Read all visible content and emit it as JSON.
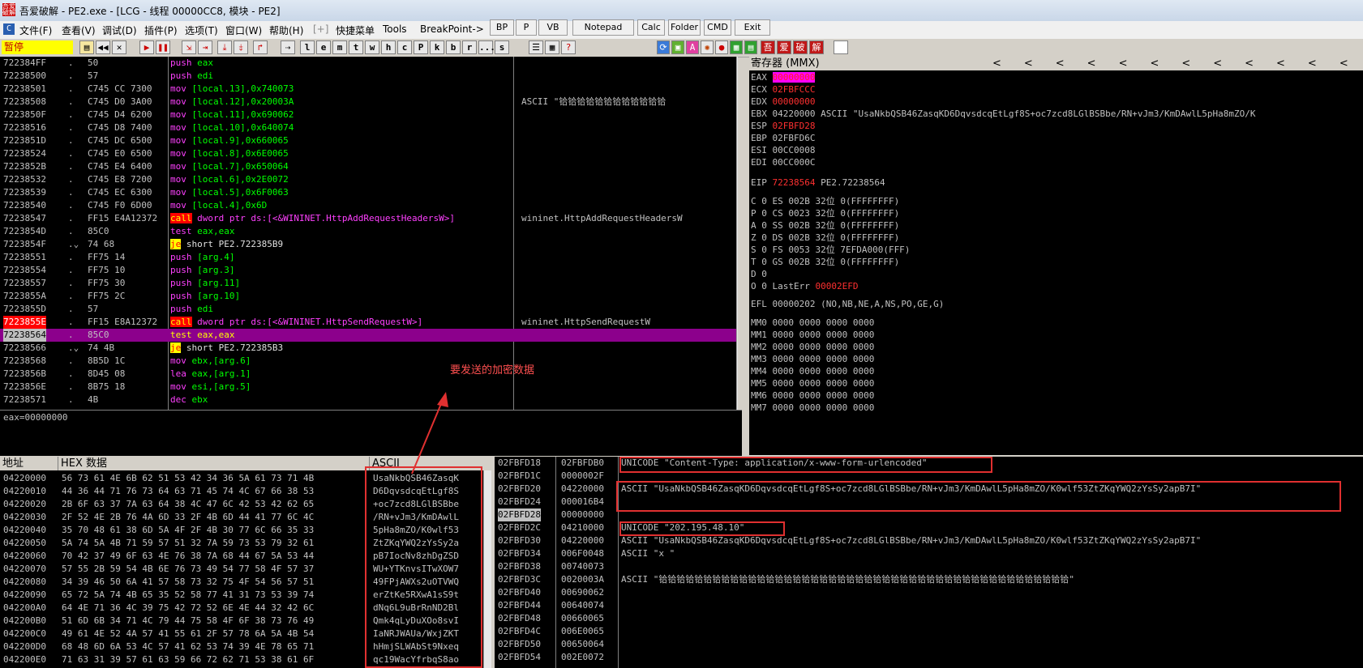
{
  "window": {
    "title": "吾爱破解 - PE2.exe - [LCG - 线程 00000CC8, 模块 - PE2]",
    "logo_text": "吾爱破解"
  },
  "menu": [
    "文件(F)",
    "查看(V)",
    "调试(D)",
    "插件(P)",
    "选项(T)",
    "窗口(W)",
    "帮助(H)",
    "[+]",
    "快捷菜单",
    "Tools",
    "BreakPoint->"
  ],
  "tool_buttons": [
    "BP",
    "P",
    "VB",
    "Notepad",
    "Calc",
    "Folder",
    "CMD",
    "Exit"
  ],
  "toolbar": {
    "status": "暂停",
    "letters": [
      "l",
      "e",
      "m",
      "t",
      "w",
      "h",
      "c",
      "P",
      "k",
      "b",
      "r",
      "...",
      "s"
    ],
    "right_icons": [
      "吾",
      "爱",
      "破",
      "解"
    ]
  },
  "disasm": {
    "rows": [
      {
        "addr": "722384FF",
        "mark": ".",
        "hex": "50",
        "m": "push",
        "a": "eax",
        "cmt": ""
      },
      {
        "addr": "72238500",
        "mark": ".",
        "hex": "57",
        "m": "push",
        "a": "edi",
        "cmt": ""
      },
      {
        "addr": "72238501",
        "mark": ".",
        "hex": "C745 CC 7300",
        "m": "mov",
        "a": "[local.13],0x740073",
        "cmt": ""
      },
      {
        "addr": "72238508",
        "mark": ".",
        "hex": "C745 D0 3A00",
        "m": "mov",
        "a": "[local.12],0x20003A",
        "cmt": "ASCII \"铪铪铪铪铪铪铪铪铪铪铪铪"
      },
      {
        "addr": "7223850F",
        "mark": ".",
        "hex": "C745 D4 6200",
        "m": "mov",
        "a": "[local.11],0x690062",
        "cmt": ""
      },
      {
        "addr": "72238516",
        "mark": ".",
        "hex": "C745 D8 7400",
        "m": "mov",
        "a": "[local.10],0x640074",
        "cmt": ""
      },
      {
        "addr": "7223851D",
        "mark": ".",
        "hex": "C745 DC 6500",
        "m": "mov",
        "a": "[local.9],0x660065",
        "cmt": ""
      },
      {
        "addr": "72238524",
        "mark": ".",
        "hex": "C745 E0 6500",
        "m": "mov",
        "a": "[local.8],0x6E0065",
        "cmt": ""
      },
      {
        "addr": "7223852B",
        "mark": ".",
        "hex": "C745 E4 6400",
        "m": "mov",
        "a": "[local.7],0x650064",
        "cmt": ""
      },
      {
        "addr": "72238532",
        "mark": ".",
        "hex": "C745 E8 7200",
        "m": "mov",
        "a": "[local.6],0x2E0072",
        "cmt": ""
      },
      {
        "addr": "72238539",
        "mark": ".",
        "hex": "C745 EC 6300",
        "m": "mov",
        "a": "[local.5],0x6F0063",
        "cmt": ""
      },
      {
        "addr": "72238540",
        "mark": ".",
        "hex": "C745 F0 6D00",
        "m": "mov",
        "a": "[local.4],0x6D",
        "cmt": ""
      },
      {
        "addr": "72238547",
        "mark": ".",
        "hex": "FF15 E4A12372",
        "m": "call",
        "a": "dword ptr ds:[<&WININET.HttpAddRequestHeadersW>]",
        "cmt": "wininet.HttpAddRequestHeadersW"
      },
      {
        "addr": "7223854D",
        "mark": ".",
        "hex": "85C0",
        "m": "test",
        "a": "eax,eax",
        "cmt": ""
      },
      {
        "addr": "7223854F",
        "mark": ".⌄",
        "hex": "74 68",
        "m": "je",
        "a": "short PE2.722385B9",
        "cmt": ""
      },
      {
        "addr": "72238551",
        "mark": ".",
        "hex": "FF75 14",
        "m": "push",
        "a": "[arg.4]",
        "cmt": ""
      },
      {
        "addr": "72238554",
        "mark": ".",
        "hex": "FF75 10",
        "m": "push",
        "a": "[arg.3]",
        "cmt": ""
      },
      {
        "addr": "72238557",
        "mark": ".",
        "hex": "FF75 30",
        "m": "push",
        "a": "[arg.11]",
        "cmt": ""
      },
      {
        "addr": "7223855A",
        "mark": ".",
        "hex": "FF75 2C",
        "m": "push",
        "a": "[arg.10]",
        "cmt": ""
      },
      {
        "addr": "7223855D",
        "mark": ".",
        "hex": "57",
        "m": "push",
        "a": "edi",
        "cmt": ""
      },
      {
        "addr": "7223855E",
        "mark": ".",
        "hex": "FF15 E8A12372",
        "m": "call",
        "a": "dword ptr ds:[<&WININET.HttpSendRequestW>]",
        "cmt": "wininet.HttpSendRequestW"
      },
      {
        "addr": "72238564",
        "mark": ".",
        "hex": "85C0",
        "m": "test",
        "a": "eax,eax",
        "cmt": ""
      },
      {
        "addr": "72238566",
        "mark": ".⌄",
        "hex": "74 4B",
        "m": "je",
        "a": "short PE2.722385B3",
        "cmt": ""
      },
      {
        "addr": "72238568",
        "mark": ".",
        "hex": "8B5D 1C",
        "m": "mov",
        "a": "ebx,[arg.6]",
        "cmt": ""
      },
      {
        "addr": "7223856B",
        "mark": ".",
        "hex": "8D45 08",
        "m": "lea",
        "a": "eax,[arg.1]",
        "cmt": ""
      },
      {
        "addr": "7223856E",
        "mark": ".",
        "hex": "8B75 18",
        "m": "mov",
        "a": "esi,[arg.5]",
        "cmt": ""
      },
      {
        "addr": "72238571",
        "mark": ".",
        "hex": "4B",
        "m": "dec",
        "a": "ebx",
        "cmt": ""
      }
    ],
    "annotation": "要发送的加密数据"
  },
  "info_line": "eax=00000000",
  "registers": {
    "header": "寄存器 (MMX)",
    "lines": [
      {
        "n": "EAX",
        "v": "00000000",
        "x": "",
        "chg": true
      },
      {
        "n": "ECX",
        "v": "02FBFCCC",
        "x": "",
        "chg": true
      },
      {
        "n": "EDX",
        "v": "00000000",
        "x": "",
        "chg": true
      },
      {
        "n": "EBX",
        "v": "04220000",
        "x": "ASCII \"UsaNkbQSB46ZasqKD6DqvsdcqEtLgf8S+oc7zcd8LGlBSBbe/RN+vJm3/KmDAwlL5pHa8mZO/K",
        "chg": false
      },
      {
        "n": "ESP",
        "v": "02FBFD28",
        "x": "",
        "chg": true
      },
      {
        "n": "EBP",
        "v": "02FBFD6C",
        "x": "",
        "chg": false
      },
      {
        "n": "ESI",
        "v": "00CC0008",
        "x": "",
        "chg": false
      },
      {
        "n": "EDI",
        "v": "00CC000C",
        "x": "",
        "chg": false
      }
    ],
    "eip": {
      "n": "EIP",
      "v": "72238564",
      "x": "PE2.72238564"
    },
    "flags": [
      "C 0  ES 002B 32位 0(FFFFFFFF)",
      "P 0  CS 0023 32位 0(FFFFFFFF)",
      "A 0  SS 002B 32位 0(FFFFFFFF)",
      "Z 0  DS 002B 32位 0(FFFFFFFF)",
      "S 0  FS 0053 32位 7EFDA000(FFF)",
      "T 0  GS 002B 32位 0(FFFFFFFF)",
      "D 0",
      "O 0  LastErr "
    ],
    "lasterr": "00002EFD",
    "efl": "EFL 00000202 (NO,NB,NE,A,NS,PO,GE,G)",
    "mmx": [
      "MM0 0000 0000 0000 0000",
      "MM1 0000 0000 0000 0000",
      "MM2 0000 0000 0000 0000",
      "MM3 0000 0000 0000 0000",
      "MM4 0000 0000 0000 0000",
      "MM5 0000 0000 0000 0000",
      "MM6 0000 0000 0000 0000",
      "MM7 0000 0000 0000 0000"
    ]
  },
  "dump": {
    "headers": {
      "addr": "地址",
      "hex": "HEX 数据",
      "ascii": "ASCII"
    },
    "rows": [
      {
        "a": "04220000",
        "h": "56 73 61 4E 6B 62 51 53 42 34 36 5A 61 73 71 4B",
        "s": "UsaNkbQSB46ZasqK"
      },
      {
        "a": "04220010",
        "h": "44 36 44 71 76 73 64 63 71 45 74 4C 67 66 38 53",
        "s": "D6DqvsdcqEtLgf8S"
      },
      {
        "a": "04220020",
        "h": "2B 6F 63 37 7A 63 64 38 4C 47 6C 42 53 42 62 65",
        "s": "+oc7zcd8LGlBSBbe"
      },
      {
        "a": "04220030",
        "h": "2F 52 4E 2B 76 4A 6D 33 2F 4B 6D 44 41 77 6C 4C",
        "s": "/RN+vJm3/KmDAwlL"
      },
      {
        "a": "04220040",
        "h": "35 70 48 61 38 6D 5A 4F 2F 4B 30 77 6C 66 35 33",
        "s": "5pHa8mZO/K0wlf53"
      },
      {
        "a": "04220050",
        "h": "5A 74 5A 4B 71 59 57 51 32 7A 59 73 53 79 32 61",
        "s": "ZtZKqYWQ2zYsSy2a"
      },
      {
        "a": "04220060",
        "h": "70 42 37 49 6F 63 4E 76 38 7A 68 44 67 5A 53 44",
        "s": "pB7IocNv8zhDgZSD"
      },
      {
        "a": "04220070",
        "h": "57 55 2B 59 54 4B 6E 76 73 49 54 77 58 4F 57 37",
        "s": "WU+YTKnvsITwXOW7"
      },
      {
        "a": "04220080",
        "h": "34 39 46 50 6A 41 57 58 73 32 75 4F 54 56 57 51",
        "s": "49FPjAWXs2uOTVWQ"
      },
      {
        "a": "04220090",
        "h": "65 72 5A 74 4B 65 35 52 58 77 41 31 73 53 39 74",
        "s": "erZtKe5RXwA1sS9t"
      },
      {
        "a": "042200A0",
        "h": "64 4E 71 36 4C 39 75 42 72 52 6E 4E 44 32 42 6C",
        "s": "dNq6L9uBrRnND2Bl"
      },
      {
        "a": "042200B0",
        "h": "51 6D 6B 34 71 4C 79 44 75 58 4F 6F 38 73 76 49",
        "s": "Qmk4qLyDuXOo8svI"
      },
      {
        "a": "042200C0",
        "h": "49 61 4E 52 4A 57 41 55 61 2F 57 78 6A 5A 4B 54",
        "s": "IaNRJWAUa/WxjZKT"
      },
      {
        "a": "042200D0",
        "h": "68 48 6D 6A 53 4C 57 41 62 53 74 39 4E 78 65 71",
        "s": "hHmjSLWAbSt9Nxeq"
      },
      {
        "a": "042200E0",
        "h": "71 63 31 39 57 61 63 59 66 72 62 71 53 38 61 6F",
        "s": "qc19WacYfrbqS8ao"
      }
    ]
  },
  "stack": {
    "rows": [
      {
        "a": "02FBFD18",
        "v": "02FBFDB0",
        "c": "UNICODE \"Content-Type: application/x-www-form-urlencoded\""
      },
      {
        "a": "02FBFD1C",
        "v": "0000002F",
        "c": ""
      },
      {
        "a": "02FBFD20",
        "v": "04220000",
        "c": "ASCII \"UsaNkbQSB46ZasqKD6DqvsdcqEtLgf8S+oc7zcd8LGlBSBbe/RN+vJm3/KmDAwlL5pHa8mZO/K0wlf53ZtZKqYWQ2zYsSy2apB7I\""
      },
      {
        "a": "02FBFD24",
        "v": "000016B4",
        "c": ""
      },
      {
        "a": "02FBFD28",
        "v": "00000000",
        "c": ""
      },
      {
        "a": "02FBFD2C",
        "v": "04210000",
        "c": "UNICODE \"202.195.48.10\""
      },
      {
        "a": "02FBFD30",
        "v": "04220000",
        "c": "ASCII \"UsaNkbQSB46ZasqKD6DqvsdcqEtLgf8S+oc7zcd8LGlBSBbe/RN+vJm3/KmDAwlL5pHa8mZO/K0wlf53ZtZKqYWQ2zYsSy2apB7I\""
      },
      {
        "a": "02FBFD34",
        "v": "006F0048",
        "c": "ASCII \"x \""
      },
      {
        "a": "02FBFD38",
        "v": "00740073",
        "c": ""
      },
      {
        "a": "02FBFD3C",
        "v": "0020003A",
        "c": "ASCII \"铪铪铪铪铪铪铪铪铪铪铪铪铪铪铪铪铪铪铪铪铪铪铪铪铪铪铪铪铪铪铪铪铪铪铪铪铪铪铪铪铪铪铪铪铪铪\""
      },
      {
        "a": "02FBFD40",
        "v": "00690062",
        "c": ""
      },
      {
        "a": "02FBFD44",
        "v": "00640074",
        "c": ""
      },
      {
        "a": "02FBFD48",
        "v": "00660065",
        "c": ""
      },
      {
        "a": "02FBFD4C",
        "v": "006E0065",
        "c": ""
      },
      {
        "a": "02FBFD50",
        "v": "00650064",
        "c": ""
      },
      {
        "a": "02FBFD54",
        "v": "002E0072",
        "c": ""
      }
    ]
  }
}
